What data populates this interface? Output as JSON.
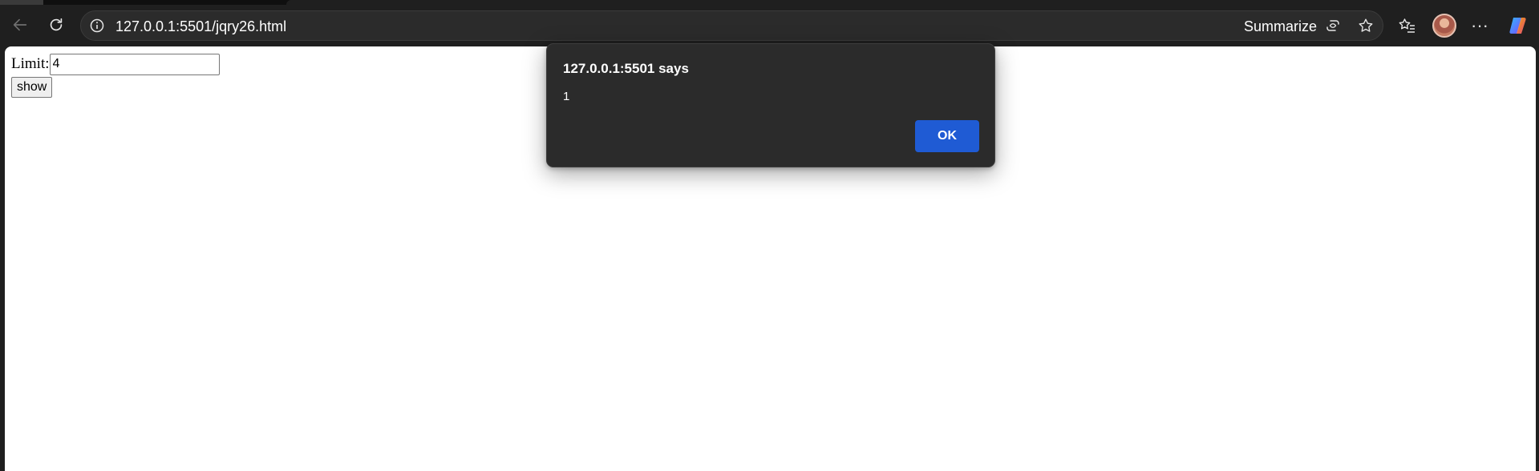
{
  "browser": {
    "url": "127.0.0.1:5501/jqry26.html",
    "summarize_label": "Summarize",
    "more_label": "···"
  },
  "page": {
    "limit_label": "Limit:",
    "limit_value": "4",
    "show_button": "show"
  },
  "dialog": {
    "title": "127.0.0.1:5501 says",
    "message": "1",
    "ok_button": "OK"
  },
  "colors": {
    "browser_chrome": "#1f1f1f",
    "dialog_background": "#2b2b2b",
    "ok_button": "#1f5bd4"
  },
  "icons": [
    "back-arrow-icon",
    "refresh-icon",
    "info-icon",
    "summarize-icon",
    "favorite-star-icon",
    "favorites-list-icon",
    "profile-avatar",
    "more-menu-icon",
    "copilot-icon"
  ]
}
